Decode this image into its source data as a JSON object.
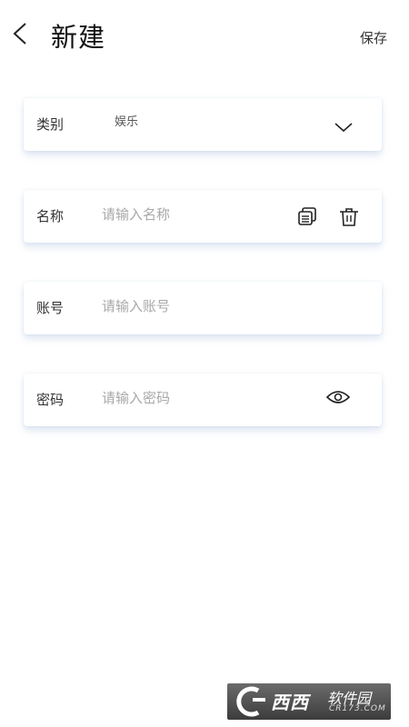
{
  "header": {
    "title": "新建",
    "save_label": "保存"
  },
  "form": {
    "category": {
      "label": "类别",
      "value": "娱乐"
    },
    "name": {
      "label": "名称",
      "placeholder": "请输入名称"
    },
    "account": {
      "label": "账号",
      "placeholder": "请输入账号"
    },
    "password": {
      "label": "密码",
      "placeholder": "请输入密码"
    }
  },
  "icons": {
    "back": "chevron-left-icon",
    "dropdown": "chevron-down-icon",
    "copy": "copy-icon",
    "delete": "trash-icon",
    "visibility": "eye-icon"
  },
  "watermark": {
    "brand": "西西",
    "suffix": "软件园",
    "site": "CR173.COM"
  },
  "colors": {
    "card_shadow": "#8caad2",
    "placeholder": "#a8a8a8"
  }
}
